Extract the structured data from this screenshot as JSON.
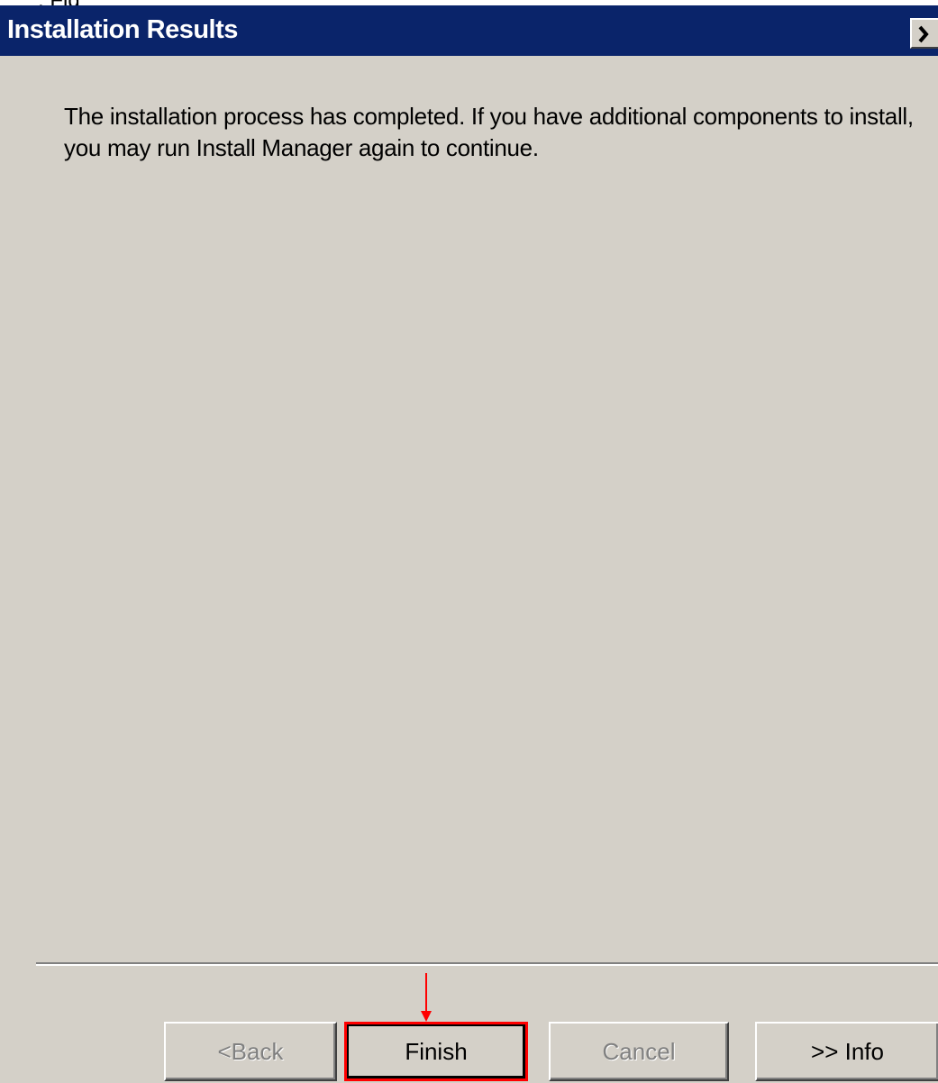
{
  "top": {
    "link_text": "  ",
    "text_fragment": ", Fig"
  },
  "window": {
    "title": "Installation Results",
    "close_icon": "close-x-icon"
  },
  "message": "The installation process has completed.  If you have additional components to install, you may run Install Manager again to continue.",
  "buttons": {
    "back": "<Back",
    "finish": "Finish",
    "cancel": "Cancel",
    "info": ">> Info"
  },
  "annotation": {
    "arrow_color": "#ff0000",
    "highlight_color": "#ff0000"
  }
}
